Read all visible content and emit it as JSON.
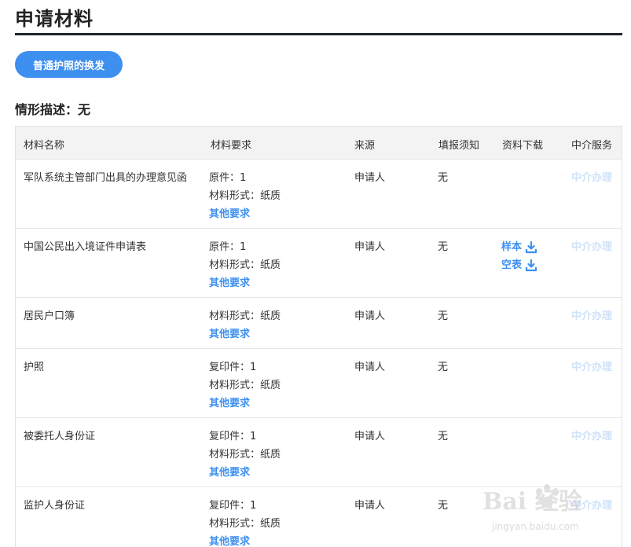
{
  "section": {
    "title": "申请材料"
  },
  "situation_button": {
    "label": "普通护照的换发"
  },
  "situation": {
    "text": "情形描述：无"
  },
  "table": {
    "headers": [
      "材料名称",
      "材料要求",
      "来源",
      "填报须知",
      "资料下载",
      "中介服务"
    ],
    "rows": [
      {
        "name": "军队系统主管部门出具的办理意见函",
        "req": [
          "原件：1",
          "材料形式：纸质"
        ],
        "other": "其他要求",
        "source": "申请人",
        "fill": "无",
        "downloads": [],
        "service": "中介办理"
      },
      {
        "name": "中国公民出入境证件申请表",
        "req": [
          "原件：1",
          "材料形式：纸质"
        ],
        "other": "其他要求",
        "source": "申请人",
        "fill": "无",
        "downloads": [
          "样本",
          "空表"
        ],
        "service": "中介办理"
      },
      {
        "name": "居民户口簿",
        "req": [
          "材料形式：纸质"
        ],
        "other": "其他要求",
        "source": "申请人",
        "fill": "无",
        "downloads": [],
        "service": "中介办理"
      },
      {
        "name": "护照",
        "req": [
          "复印件：1",
          "材料形式：纸质"
        ],
        "other": "其他要求",
        "source": "申请人",
        "fill": "无",
        "downloads": [],
        "service": "中介办理"
      },
      {
        "name": "被委托人身份证",
        "req": [
          "复印件：1",
          "材料形式：纸质"
        ],
        "other": "其他要求",
        "source": "申请人",
        "fill": "无",
        "downloads": [],
        "service": "中介办理"
      },
      {
        "name": "监护人身份证",
        "req": [
          "复印件：1",
          "材料形式：纸质"
        ],
        "other": "其他要求",
        "source": "申请人",
        "fill": "无",
        "downloads": [],
        "service": "中介办理"
      }
    ]
  },
  "icons": {
    "download": "download-icon"
  },
  "colors": {
    "accent": "#3d8ff0",
    "service_disabled": "#cfe2f8",
    "rule": "#1f2329"
  },
  "watermark": {
    "brand": "Bai 经验",
    "url": "jingyan.baidu.com"
  }
}
